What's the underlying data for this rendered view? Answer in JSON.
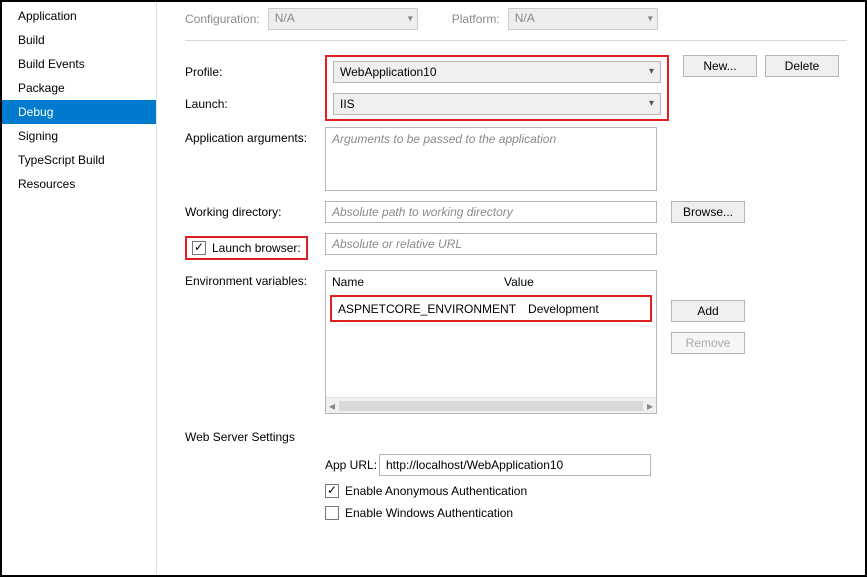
{
  "sidebar": {
    "items": [
      {
        "label": "Application"
      },
      {
        "label": "Build"
      },
      {
        "label": "Build Events"
      },
      {
        "label": "Package"
      },
      {
        "label": "Debug"
      },
      {
        "label": "Signing"
      },
      {
        "label": "TypeScript Build"
      },
      {
        "label": "Resources"
      }
    ],
    "active_index": 4
  },
  "configBar": {
    "configuration_label": "Configuration:",
    "configuration_value": "N/A",
    "platform_label": "Platform:",
    "platform_value": "N/A"
  },
  "profile": {
    "label": "Profile:",
    "value": "WebApplication10",
    "new_button": "New...",
    "delete_button": "Delete"
  },
  "launch": {
    "label": "Launch:",
    "value": "IIS"
  },
  "appArgs": {
    "label": "Application arguments:",
    "placeholder": "Arguments to be passed to the application"
  },
  "workingDir": {
    "label": "Working directory:",
    "placeholder": "Absolute path to working directory",
    "browse_button": "Browse..."
  },
  "launchBrowser": {
    "label": "Launch browser:",
    "checked": true,
    "url_placeholder": "Absolute or relative URL"
  },
  "envVars": {
    "label": "Environment variables:",
    "header_name": "Name",
    "header_value": "Value",
    "rows": [
      {
        "name": "ASPNETCORE_ENVIRONMENT",
        "value": "Development"
      }
    ],
    "add_button": "Add",
    "remove_button": "Remove"
  },
  "webServer": {
    "heading": "Web Server Settings",
    "app_url_label": "App URL:",
    "app_url_value": "http://localhost/WebApplication10",
    "anon_auth_label": "Enable Anonymous Authentication",
    "anon_auth_checked": true,
    "win_auth_label": "Enable Windows Authentication",
    "win_auth_checked": false
  }
}
